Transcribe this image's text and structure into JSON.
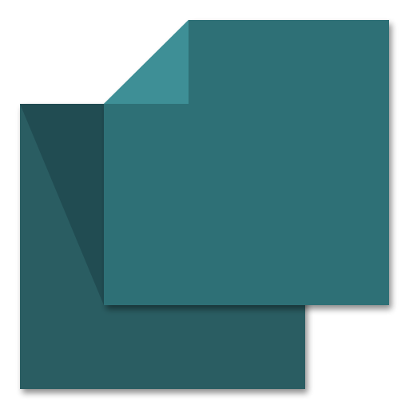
{
  "icon": {
    "name": "copy-pages-icon",
    "colors": {
      "back_page": "#2a5d62",
      "back_page_shadow_fold": "#214c52",
      "front_page": "#2e7076",
      "front_page_corner_fold": "#3e8f96",
      "drop_shadow": "#000000"
    }
  }
}
